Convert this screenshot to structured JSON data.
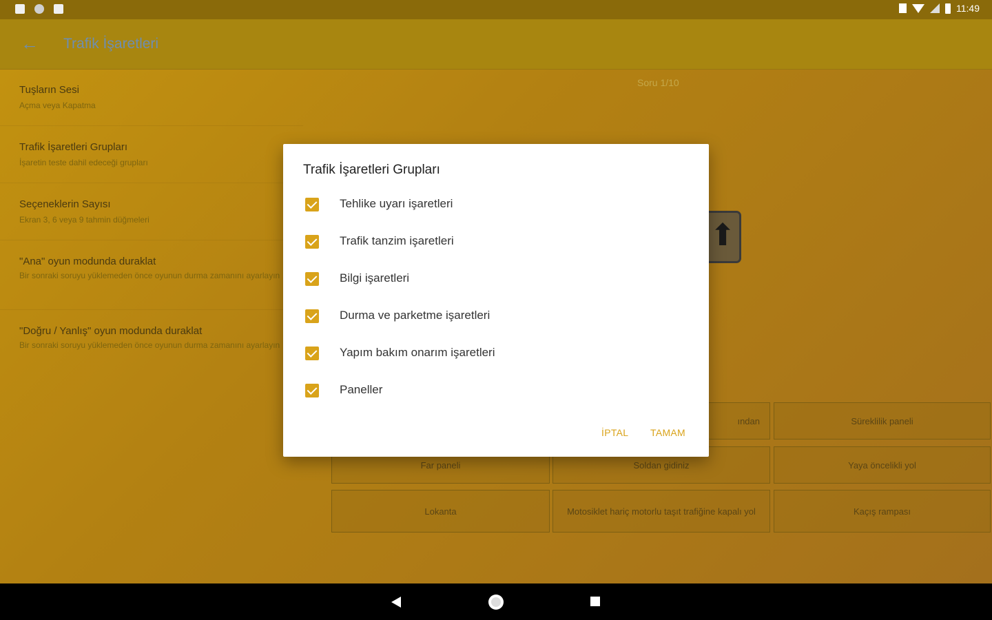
{
  "statusbar": {
    "time": "11:49"
  },
  "appbar": {
    "title": "Trafik İşaretleri"
  },
  "settings": [
    {
      "title": "Tuşların Sesi",
      "subtitle": "Açma veya Kapatma"
    },
    {
      "title": "Trafik İşaretleri Grupları",
      "subtitle": "İşaretin teste dahil edeceği grupları"
    },
    {
      "title": "Seçeneklerin Sayısı",
      "subtitle": "Ekran 3, 6 veya 9 tahmin düğmeleri"
    },
    {
      "title": "\"Ana\" oyun modunda duraklat",
      "subtitle": "Bir sonraki soruyu yüklemeden önce oyunun durma zamanını ayarlayın"
    },
    {
      "title": "\"Doğru / Yanlış\" oyun modunda duraklat",
      "subtitle": "Bir sonraki soruyu yüklemeden önce oyunun durma zamanını ayarlayın"
    }
  ],
  "quiz": {
    "question_counter": "Soru 1/10",
    "options": [
      "ından",
      "Süreklilik paneli",
      "Far paneli",
      "Soldan gidiniz",
      "Yaya öncelikli yol",
      "Lokanta",
      "Motosiklet hariç motorlu taşıt trafiğine kapalı yol",
      "Kaçış rampası"
    ]
  },
  "dialog": {
    "title": "Trafik İşaretleri Grupları",
    "items": [
      {
        "label": "Tehlike uyarı işaretleri",
        "checked": true
      },
      {
        "label": "Trafik tanzim işaretleri",
        "checked": true
      },
      {
        "label": "Bilgi işaretleri",
        "checked": true
      },
      {
        "label": "Durma ve parketme işaretleri",
        "checked": true
      },
      {
        "label": "Yapım bakım onarım işaretleri",
        "checked": true
      },
      {
        "label": "Paneller",
        "checked": true
      }
    ],
    "cancel_label": "İPTAL",
    "ok_label": "TAMAM",
    "accent_color": "#d9a31a"
  },
  "navbar": {
    "back_icon": "back-triangle-icon",
    "home_icon": "home-circle-icon",
    "recent_icon": "recents-square-icon"
  }
}
